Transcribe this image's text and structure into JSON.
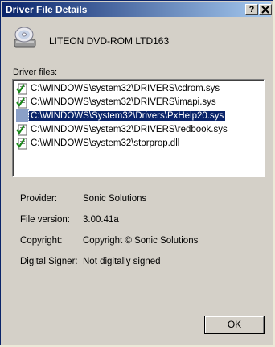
{
  "window": {
    "title": "Driver File Details"
  },
  "titlebar": {
    "help_label": "?",
    "close_label": "X"
  },
  "device": {
    "name": "LITEON DVD-ROM LTD163",
    "icon": "optical-drive-icon"
  },
  "files_label_prefix": "D",
  "files_label_rest": "river files:",
  "files": [
    {
      "path": "C:\\WINDOWS\\system32\\DRIVERS\\cdrom.sys",
      "signed": true,
      "selected": false
    },
    {
      "path": "C:\\WINDOWS\\system32\\DRIVERS\\imapi.sys",
      "signed": true,
      "selected": false
    },
    {
      "path": "C:\\WINDOWS\\System32\\Drivers\\PxHelp20.sys",
      "signed": false,
      "selected": true
    },
    {
      "path": "C:\\WINDOWS\\system32\\DRIVERS\\redbook.sys",
      "signed": true,
      "selected": false
    },
    {
      "path": "C:\\WINDOWS\\system32\\storprop.dll",
      "signed": true,
      "selected": false
    }
  ],
  "properties": [
    {
      "label": "Provider:",
      "value": "Sonic Solutions"
    },
    {
      "label": "File version:",
      "value": "3.00.41a"
    },
    {
      "label": "Copyright:",
      "value": "Copyright © Sonic Solutions"
    },
    {
      "label": "Digital Signer:",
      "value": "Not digitally signed"
    }
  ],
  "ok_button": {
    "label": "OK"
  },
  "colors": {
    "titlebar_start": "#0a246a",
    "titlebar_end": "#a6caf0",
    "selection": "#0a246a",
    "face": "#d4d0c8"
  }
}
